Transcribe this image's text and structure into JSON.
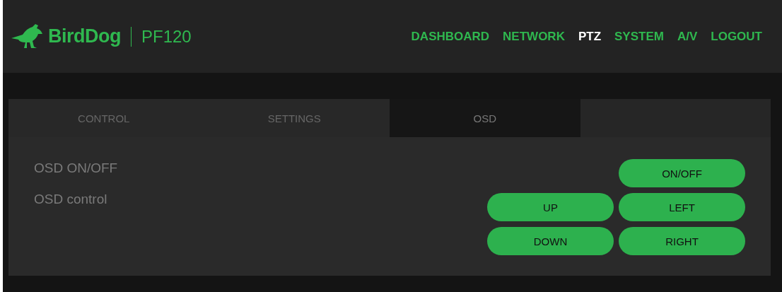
{
  "header": {
    "brand": "BirdDog",
    "model": "PF120"
  },
  "nav": [
    {
      "label": "DASHBOARD",
      "selected": false
    },
    {
      "label": "NETWORK",
      "selected": false
    },
    {
      "label": "PTZ",
      "selected": true
    },
    {
      "label": "SYSTEM",
      "selected": false
    },
    {
      "label": "A/V",
      "selected": false
    },
    {
      "label": "LOGOUT",
      "selected": false
    }
  ],
  "tabs": [
    {
      "label": "CONTROL",
      "selected": false
    },
    {
      "label": "SETTINGS",
      "selected": false
    },
    {
      "label": "OSD",
      "selected": true
    }
  ],
  "osd_rows": [
    {
      "label": "OSD ON/OFF",
      "buttons": [
        "ON/OFF"
      ]
    },
    {
      "label": "OSD control",
      "buttons": [
        "UP",
        "LEFT",
        "DOWN",
        "RIGHT"
      ]
    }
  ]
}
